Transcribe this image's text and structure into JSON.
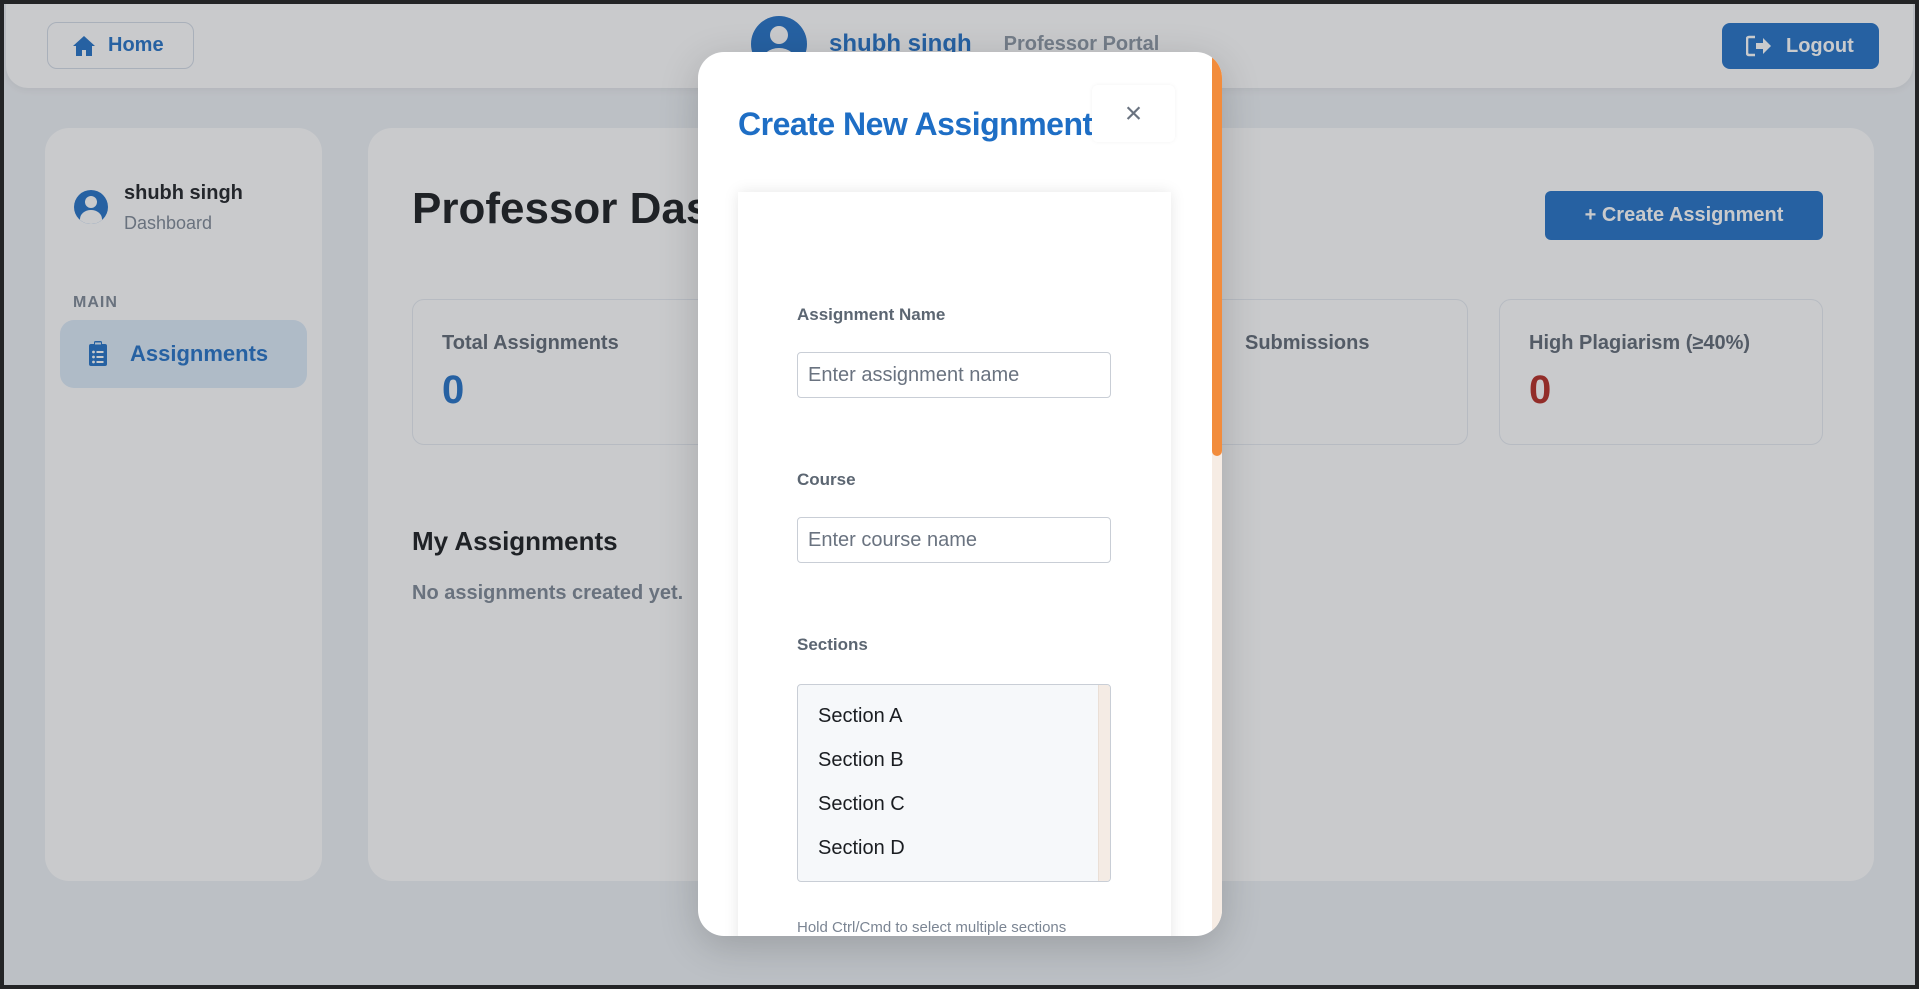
{
  "header": {
    "home_label": "Home",
    "user_name": "shubh singh",
    "portal_label": "Professor Portal",
    "logout_label": "Logout"
  },
  "sidebar": {
    "user_name": "shubh singh",
    "user_role": "Dashboard",
    "section_label": "MAIN",
    "items": [
      {
        "label": "Assignments",
        "icon": "clipboard-list-icon"
      }
    ]
  },
  "main": {
    "title": "Professor Dashboard",
    "create_button": "+ Create Assignment",
    "stats": [
      {
        "label": "Total Assignments",
        "value": "0",
        "color": "#1e6ec5"
      },
      {
        "label": "Submissions",
        "value": "",
        "color": "#1e6ec5"
      },
      {
        "label": "High Plagiarism (≥40%)",
        "value": "0",
        "color": "#b3261e"
      }
    ],
    "section_title": "My Assignments",
    "empty_text": "No assignments created yet."
  },
  "modal": {
    "title": "Create New Assignment",
    "close_symbol": "×",
    "fields": {
      "name_label": "Assignment Name",
      "name_placeholder": "Enter assignment name",
      "course_label": "Course",
      "course_placeholder": "Enter course name",
      "sections_label": "Sections",
      "sections_options": [
        "Section A",
        "Section B",
        "Section C",
        "Section D"
      ],
      "sections_hint": "Hold Ctrl/Cmd to select multiple sections"
    }
  },
  "colors": {
    "primary": "#1e6ec5",
    "danger": "#b3261e",
    "scroll_accent": "#f28c3c"
  }
}
